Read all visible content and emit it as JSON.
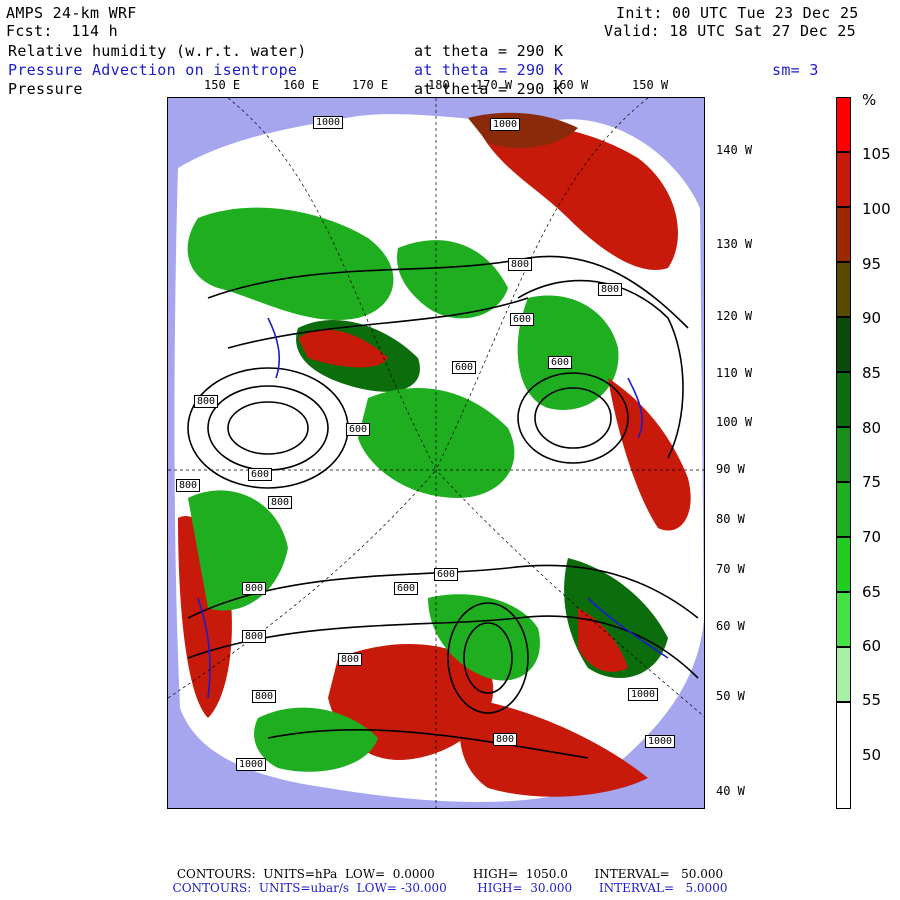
{
  "header": {
    "model": "AMPS 24-km WRF",
    "fcst": "Fcst:  114 h",
    "init": "Init: 00 UTC Tue 23 Dec 25",
    "valid": "Valid: 18 UTC Sat 27 Dec 25",
    "fields": [
      {
        "name": "Relative humidity (w.r.t. water)",
        "level": "at theta = 290 K",
        "extra": "",
        "color": "#000000"
      },
      {
        "name": "Pressure Advection on isentrope",
        "level": "at theta = 290 K",
        "extra": "sm= 3",
        "color": "#1c1ccc"
      },
      {
        "name": "Pressure",
        "level": "at theta = 290 K",
        "extra": "",
        "color": "#000000"
      }
    ]
  },
  "map": {
    "lon_labels_top": [
      "150 E",
      "160 E",
      "170 E",
      "180",
      "170 W",
      "160 W",
      "150 W"
    ],
    "lat_labels_right": [
      "140 W",
      "130 W",
      "120 W",
      "110 W",
      "100 W",
      "90 W",
      "80 W",
      "70 W",
      "60 W",
      "50 W",
      "40 W"
    ],
    "contour_labels": [
      "1000",
      "800",
      "600",
      "800",
      "600",
      "800",
      "600",
      "800",
      "600",
      "800",
      "600",
      "800",
      "600",
      "800",
      "600",
      "800",
      "1000",
      "1000",
      "800",
      "1000",
      "1000",
      "800"
    ],
    "colors": {
      "ocean": "#a6a6ee",
      "green": "#1fae1f",
      "darkgreen": "#0b6d0b",
      "red": "#c81a0a",
      "brown": "#8a2a0a"
    }
  },
  "colorbar": {
    "unit": "%",
    "labels": [
      "105",
      "100",
      "95",
      "90",
      "85",
      "80",
      "75",
      "70",
      "65",
      "60",
      "55",
      "50"
    ],
    "colors": [
      "#ff0000",
      "#c81a0a",
      "#9a2a00",
      "#5a4a00",
      "#0b4a0b",
      "#0b6d0b",
      "#1a8d1a",
      "#1fae1f",
      "#22cc22",
      "#44e244",
      "#a8f0a8",
      "#ffffff"
    ]
  },
  "footer": {
    "line1": "CONTOURS:  UNITS=hPa  LOW=  0.0000          HIGH=  1050.0       INTERVAL=   50.000",
    "line2": "CONTOURS:  UNITS=ubar/s  LOW= -30.000        HIGH=  30.000       INTERVAL=   5.0000"
  }
}
